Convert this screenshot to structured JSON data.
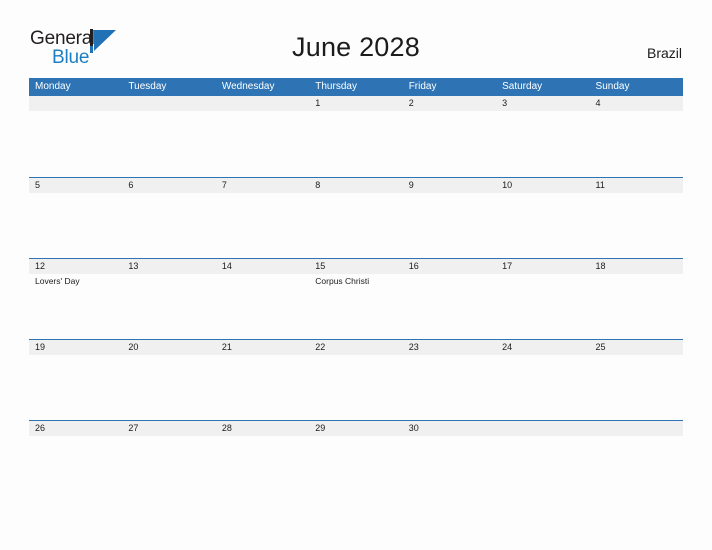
{
  "brand": {
    "name_part1": "General",
    "name_part2": "Blue",
    "mark": "triangle-logo-mark"
  },
  "header": {
    "title": "June 2028",
    "country": "Brazil"
  },
  "calendar": {
    "weekdays": [
      "Monday",
      "Tuesday",
      "Wednesday",
      "Thursday",
      "Friday",
      "Saturday",
      "Sunday"
    ],
    "accent_color": "#2e74b5",
    "date_band_color": "#f0f0f0",
    "weeks": [
      {
        "days": [
          {
            "date": "",
            "event": ""
          },
          {
            "date": "",
            "event": ""
          },
          {
            "date": "",
            "event": ""
          },
          {
            "date": "1",
            "event": ""
          },
          {
            "date": "2",
            "event": ""
          },
          {
            "date": "3",
            "event": ""
          },
          {
            "date": "4",
            "event": ""
          }
        ]
      },
      {
        "days": [
          {
            "date": "5",
            "event": ""
          },
          {
            "date": "6",
            "event": ""
          },
          {
            "date": "7",
            "event": ""
          },
          {
            "date": "8",
            "event": ""
          },
          {
            "date": "9",
            "event": ""
          },
          {
            "date": "10",
            "event": ""
          },
          {
            "date": "11",
            "event": ""
          }
        ]
      },
      {
        "days": [
          {
            "date": "12",
            "event": "Lovers' Day"
          },
          {
            "date": "13",
            "event": ""
          },
          {
            "date": "14",
            "event": ""
          },
          {
            "date": "15",
            "event": "Corpus Christi"
          },
          {
            "date": "16",
            "event": ""
          },
          {
            "date": "17",
            "event": ""
          },
          {
            "date": "18",
            "event": ""
          }
        ]
      },
      {
        "days": [
          {
            "date": "19",
            "event": ""
          },
          {
            "date": "20",
            "event": ""
          },
          {
            "date": "21",
            "event": ""
          },
          {
            "date": "22",
            "event": ""
          },
          {
            "date": "23",
            "event": ""
          },
          {
            "date": "24",
            "event": ""
          },
          {
            "date": "25",
            "event": ""
          }
        ]
      },
      {
        "days": [
          {
            "date": "26",
            "event": ""
          },
          {
            "date": "27",
            "event": ""
          },
          {
            "date": "28",
            "event": ""
          },
          {
            "date": "29",
            "event": ""
          },
          {
            "date": "30",
            "event": ""
          },
          {
            "date": "",
            "event": ""
          },
          {
            "date": "",
            "event": ""
          }
        ]
      }
    ]
  }
}
